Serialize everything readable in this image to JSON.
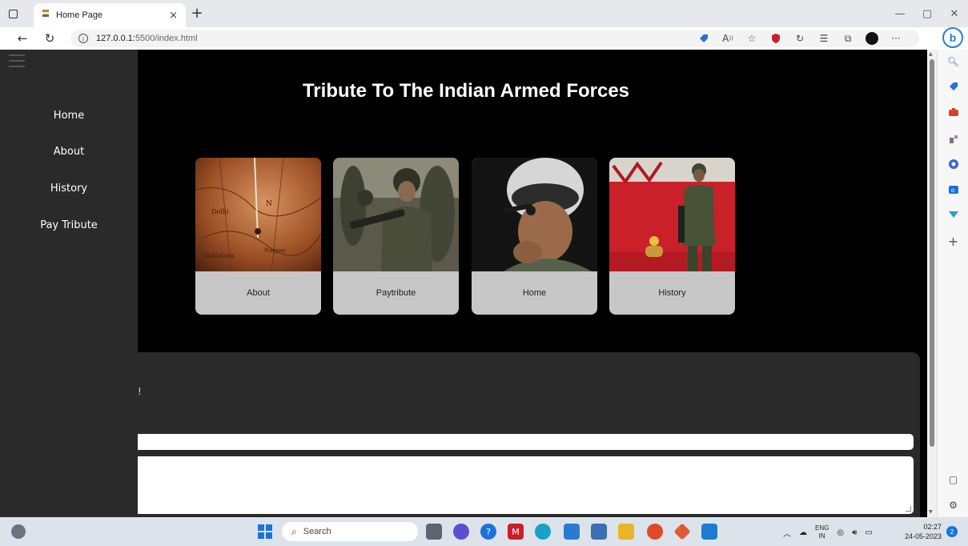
{
  "browser": {
    "tab_title": "Home Page",
    "tab_close": "×",
    "new_tab": "+",
    "url_host": "127.0.0.1:",
    "url_rest": "5500/index.html",
    "window_controls": {
      "minimize": "—",
      "restore": "▢",
      "close": "✕"
    },
    "nav": {
      "back": "←",
      "refresh": "↻"
    }
  },
  "page": {
    "title": "Tribute To The Indian Armed Forces",
    "sidenav": [
      "Home",
      "About",
      "History",
      "Pay Tribute"
    ],
    "cards": [
      {
        "label": "About",
        "image": "old-map-photo"
      },
      {
        "label": "Paytribute",
        "image": "soldiers-with-rifles-photo"
      },
      {
        "label": "Home",
        "image": "pilot-helmet-photo"
      },
      {
        "label": "History",
        "image": "soldier-ceremony-photo"
      }
    ],
    "panel_glyph": "!"
  },
  "taskbar": {
    "search_label": "Search",
    "lang_top": "ENG",
    "lang_bottom": "IN",
    "time": "02:27",
    "date": "24-05-2023",
    "notification_count": "2"
  },
  "colors": {
    "page_background": "#000000",
    "sidenav_background": "#2a2a2a",
    "card_background": "#c7c7c7",
    "accent_blue": "#1a73d9"
  }
}
